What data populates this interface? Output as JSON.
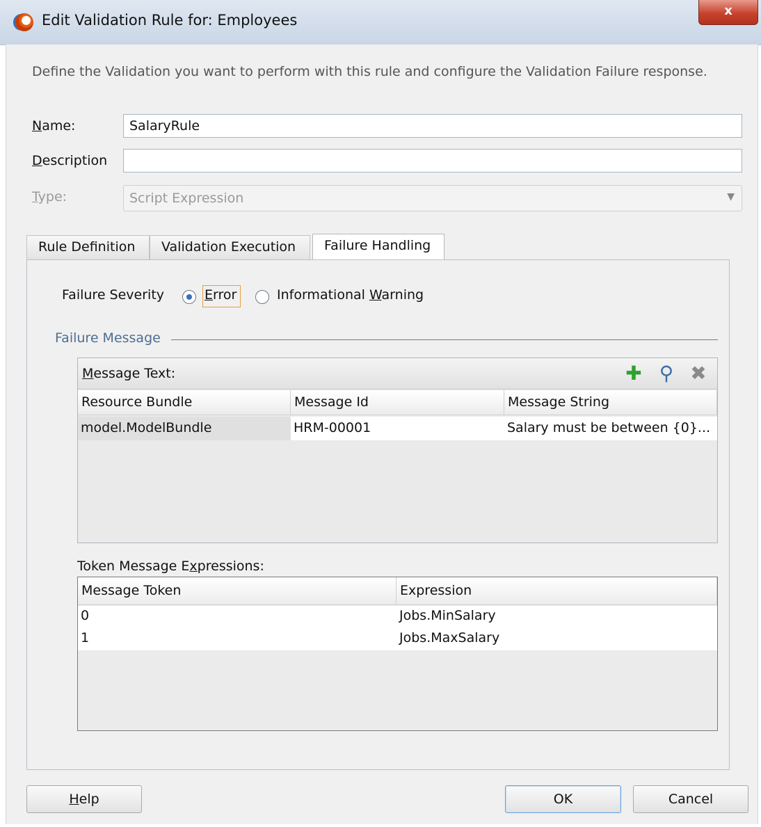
{
  "window": {
    "title": "Edit Validation Rule for: Employees",
    "close_label": "x"
  },
  "instructions": "Define the Validation you want to perform with this rule and configure the Validation Failure response.",
  "form": {
    "name_label": "Name:",
    "name_value": "SalaryRule",
    "description_label": "Description",
    "description_value": "",
    "type_label": "Type:",
    "type_value": "Script Expression"
  },
  "tabs": [
    {
      "label": "Rule Definition",
      "active": false
    },
    {
      "label": "Validation Execution",
      "active": false
    },
    {
      "label": "Failure Handling",
      "active": true
    }
  ],
  "failure_severity": {
    "label": "Failure Severity",
    "options": [
      {
        "label": "Error",
        "selected": true
      },
      {
        "label": "Informational Warning",
        "selected": false
      }
    ]
  },
  "failure_message": {
    "group_title": "Failure Message",
    "message_text_label": "Message Text:",
    "toolbar_icons": [
      "add-icon",
      "search-icon",
      "delete-icon"
    ],
    "columns": [
      "Resource Bundle",
      "Message Id",
      "Message String"
    ],
    "rows": [
      [
        "model.ModelBundle",
        "HRM-00001",
        "Salary must be between {0}..."
      ]
    ]
  },
  "token_expressions": {
    "label": "Token Message Expressions:",
    "columns": [
      "Message Token",
      "Expression"
    ],
    "rows": [
      [
        "0",
        "Jobs.MinSalary"
      ],
      [
        "1",
        "Jobs.MaxSalary"
      ]
    ]
  },
  "buttons": {
    "help": "Help",
    "ok": "OK",
    "cancel": "Cancel"
  },
  "colors": {
    "accent_radio": "#3a6fbe",
    "group_title": "#4d6e92",
    "close_button": "#c8432d"
  }
}
